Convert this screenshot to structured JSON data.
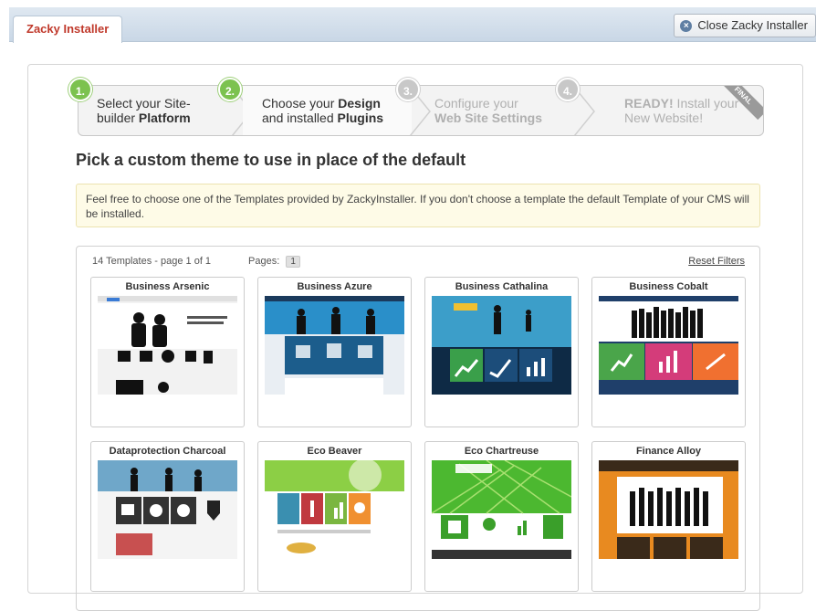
{
  "header": {
    "tab_label": "Zacky Installer",
    "close_label": "Close Zacky Installer"
  },
  "steps": [
    {
      "num": "1.",
      "line1_plain": "Select your Site-",
      "line2_plain": "builder ",
      "line2_bold": "Platform",
      "state": "active"
    },
    {
      "num": "2.",
      "line1_plain": "Choose your ",
      "line1_bold": "Design",
      "line2_plain": "and installed ",
      "line2_bold": "Plugins",
      "state": "active"
    },
    {
      "num": "3.",
      "line1_plain": "Configure your",
      "line2_bold": "Web Site Settings",
      "state": "inactive"
    },
    {
      "num": "4.",
      "line1_bold": "READY!",
      "line1_plain": " Install your",
      "line2_plain": "New Website!",
      "state": "inactive"
    }
  ],
  "ribbon_text": "FINAL",
  "main": {
    "heading": "Pick a custom theme to use in place of the default",
    "notice": "Feel free to choose one of the Templates provided by ZackyInstaller. If you don't choose a template the default Template of your CMS will be installed."
  },
  "templates": {
    "count_text": "14 Templates - page 1 of 1",
    "pages_label": "Pages:",
    "page_current": "1",
    "reset_label": "Reset Filters",
    "items": [
      {
        "name": "Business Arsenic"
      },
      {
        "name": "Business Azure"
      },
      {
        "name": "Business Cathalina"
      },
      {
        "name": "Business Cobalt"
      },
      {
        "name": "Dataprotection Charcoal"
      },
      {
        "name": "Eco Beaver"
      },
      {
        "name": "Eco Chartreuse"
      },
      {
        "name": "Finance Alloy"
      }
    ]
  },
  "colors": {
    "brand_red": "#c0392b",
    "step_green": "#7cc24f",
    "notice_bg": "#fefbe7"
  }
}
